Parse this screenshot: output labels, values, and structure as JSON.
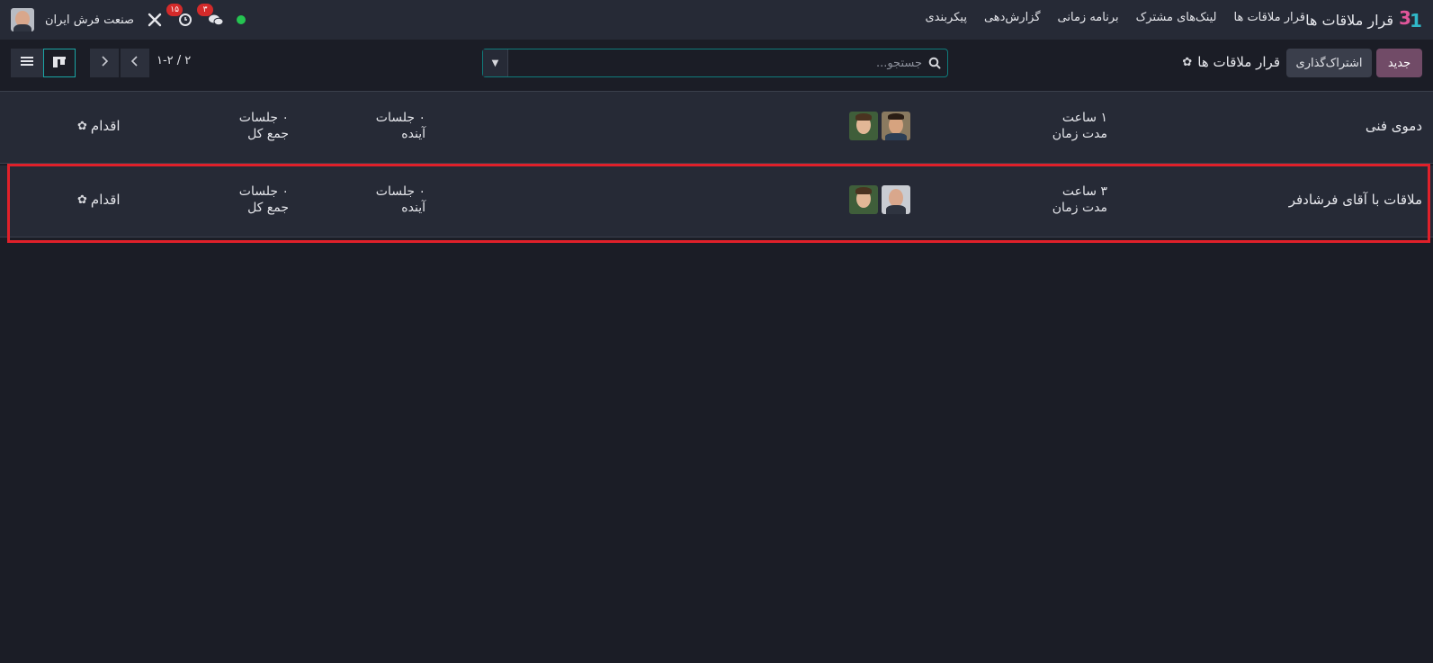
{
  "app": {
    "title": "قرار ملاقات ها",
    "logo_icon": "calendar-logo-icon"
  },
  "menu": [
    "قرار ملاقات ها",
    "لینک‌های مشترک",
    "برنامه زمانی",
    "گزارش‌دهی",
    "پیکربندی"
  ],
  "systray": {
    "company": "صنعت فرش ایران",
    "activity_badge": "۱۵",
    "messages_badge": "۳",
    "status_color": "#25c451"
  },
  "control_panel": {
    "new_label": "جدید",
    "share_label": "اشتراک‌گذاری",
    "breadcrumb": "قرار ملاقات ها",
    "search_placeholder": "جستجو...",
    "pager": "۱-۲ / ۲"
  },
  "rows": [
    {
      "name": "دموی فنی",
      "duration_value": "۱ ساعت",
      "duration_label": "مدت زمان",
      "upcoming_value": "۰ جلسات",
      "upcoming_label": "آینده",
      "total_value": "۰ جلسات",
      "total_label": "جمع کل",
      "action_label": "اقدام"
    },
    {
      "name": "ملاقات با آقای فرشادفر",
      "duration_value": "۳ ساعت",
      "duration_label": "مدت زمان",
      "upcoming_value": "۰ جلسات",
      "upcoming_label": "آینده",
      "total_value": "۰ جلسات",
      "total_label": "جمع کل",
      "action_label": "اقدام"
    }
  ],
  "colors": {
    "primary": "#714b67",
    "highlight": "#e0202a",
    "focus": "#0f7b7b"
  }
}
